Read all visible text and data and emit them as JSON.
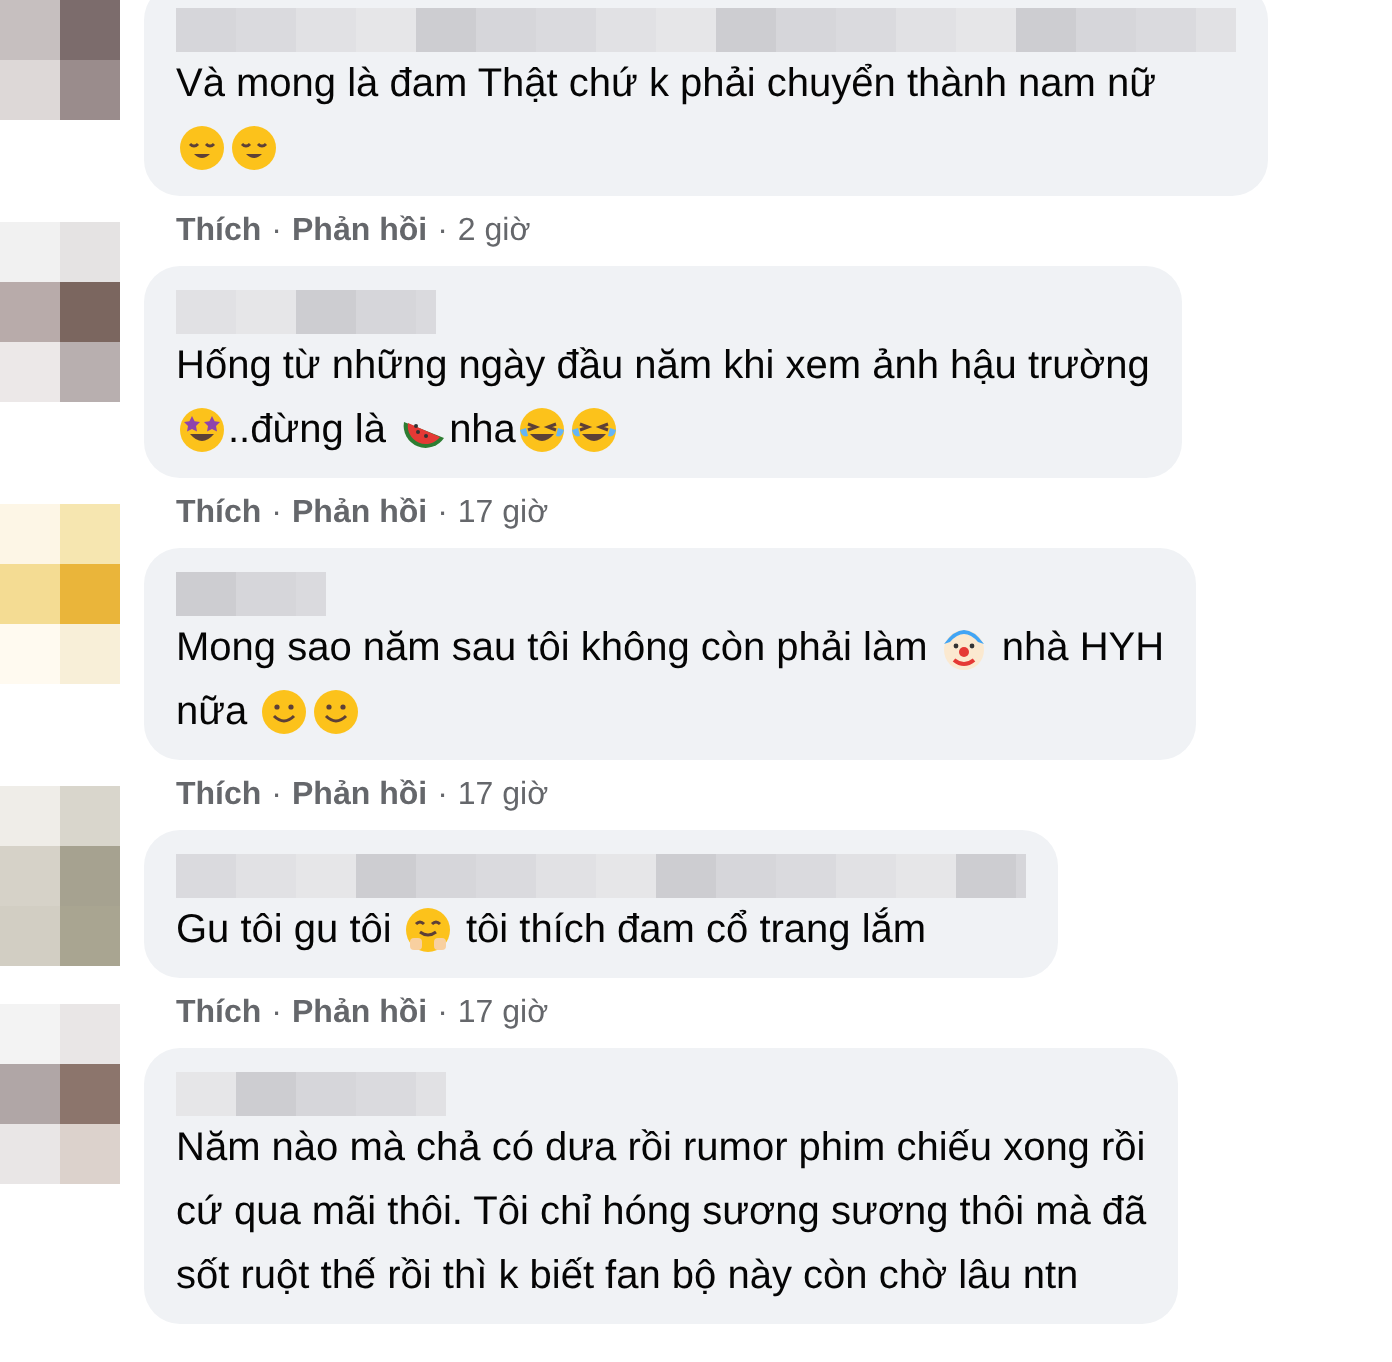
{
  "comments": [
    {
      "lines": [
        [
          {
            "kind": "text",
            "text": "Và mong là đam Thật chứ k phải chuyển thành nam nữ"
          }
        ],
        [
          {
            "kind": "relieved"
          },
          {
            "kind": "relieved"
          }
        ]
      ],
      "meta": [
        {
          "kind": "link",
          "text": "Thích"
        },
        {
          "kind": "dot",
          "text": "·"
        },
        {
          "kind": "link",
          "text": "Phản hồi"
        },
        {
          "kind": "dot",
          "text": "·"
        },
        {
          "kind": "time",
          "text": "2 giờ"
        }
      ]
    },
    {
      "lines": [
        [
          {
            "kind": "text",
            "text": "Hống từ những ngày đầu năm khi xem ảnh hậu trường"
          }
        ],
        [
          {
            "kind": "starstruck"
          },
          {
            "kind": "text",
            "text": "..đừng là "
          },
          {
            "kind": "watermelon"
          },
          {
            "kind": "text",
            "text": "nha"
          },
          {
            "kind": "laughing"
          },
          {
            "kind": "laughing"
          }
        ]
      ],
      "meta": [
        {
          "kind": "link",
          "text": "Thích"
        },
        {
          "kind": "dot",
          "text": "·"
        },
        {
          "kind": "link",
          "text": "Phản hồi"
        },
        {
          "kind": "dot",
          "text": "·"
        },
        {
          "kind": "time",
          "text": "17 giờ"
        }
      ]
    },
    {
      "lines": [
        [
          {
            "kind": "text",
            "text": "Mong sao năm sau tôi không còn phải làm "
          },
          {
            "kind": "clown"
          },
          {
            "kind": "text",
            "text": " nhà HYH"
          }
        ],
        [
          {
            "kind": "text",
            "text": "nữa "
          },
          {
            "kind": "smile"
          },
          {
            "kind": "smile"
          }
        ]
      ],
      "meta": [
        {
          "kind": "link",
          "text": "Thích"
        },
        {
          "kind": "dot",
          "text": "·"
        },
        {
          "kind": "link",
          "text": "Phản hồi"
        },
        {
          "kind": "dot",
          "text": "·"
        },
        {
          "kind": "time",
          "text": "17 giờ"
        }
      ]
    },
    {
      "lines": [
        [
          {
            "kind": "text",
            "text": "Gu tôi gu tôi "
          },
          {
            "kind": "hug"
          },
          {
            "kind": "text",
            "text": " tôi thích đam cổ trang lắm"
          }
        ]
      ],
      "meta": [
        {
          "kind": "link",
          "text": "Thích"
        },
        {
          "kind": "dot",
          "text": "·"
        },
        {
          "kind": "link",
          "text": "Phản hồi"
        },
        {
          "kind": "dot",
          "text": "·"
        },
        {
          "kind": "time",
          "text": "17 giờ"
        }
      ]
    },
    {
      "lines": [
        [
          {
            "kind": "text",
            "text": "Năm nào mà chả có dưa rồi rumor phim chiếu xong rồi"
          }
        ],
        [
          {
            "kind": "text",
            "text": "cứ qua mãi thôi. Tôi chỉ hóng sương sương thôi mà đã"
          }
        ],
        [
          {
            "kind": "text",
            "text": "sốt ruột thế rồi thì k biết fan bộ này còn chờ lâu ntn"
          }
        ]
      ]
    }
  ]
}
